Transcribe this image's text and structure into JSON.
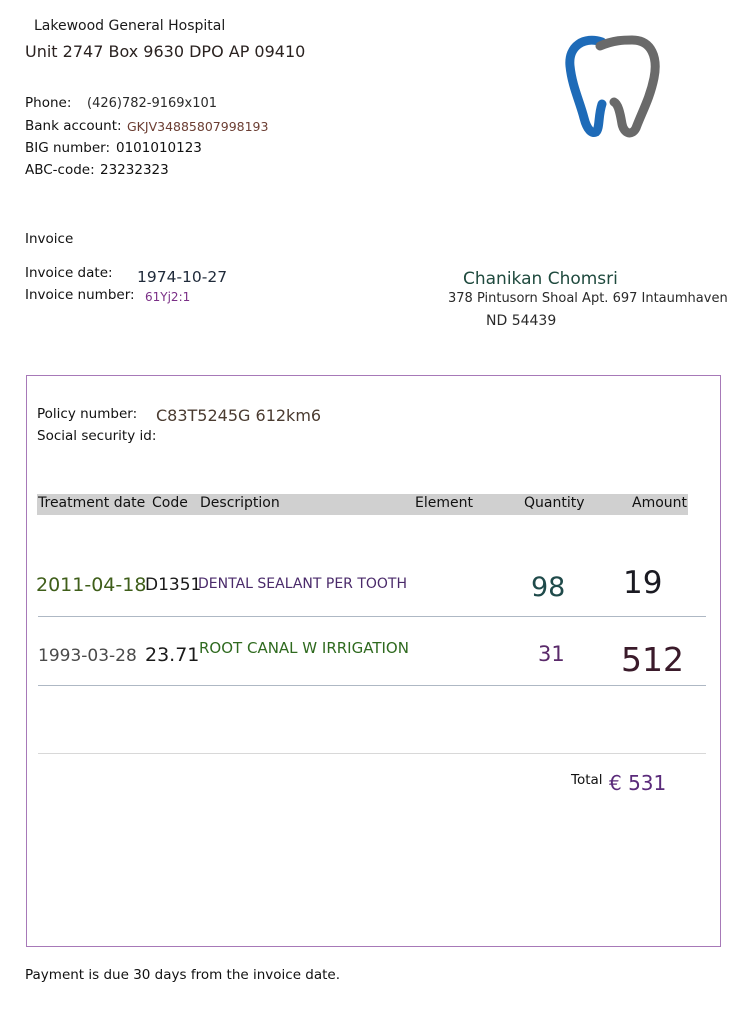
{
  "hospital": {
    "name": "Lakewood General Hospital",
    "address": "Unit 2747 Box 9630 DPO AP 09410",
    "phone_label": "Phone:",
    "phone": "(426)782-9169x101",
    "bank_label": "Bank account:",
    "bank": "GKJV34885807998193",
    "big_label": "BIG number:",
    "big": "0101010123",
    "abc_label": "ABC-code:",
    "abc": "23232323",
    "logo_icon": "tooth-logo-icon",
    "logo_colors": {
      "blue": "#1e6bb8",
      "gray": "#6a6a6a"
    }
  },
  "invoice": {
    "heading": "Invoice",
    "date_label": "Invoice date:",
    "date": "1974-10-27",
    "number_label": "Invoice number:",
    "number": "61Yj2:1"
  },
  "patient": {
    "name": "Chanikan Chomsri",
    "address_line1": "378 Pintusorn Shoal Apt. 697 Intaumhaven",
    "address_line2": "ND 54439"
  },
  "policy": {
    "policy_label": "Policy number:",
    "policy_value": "C83T5245G 612km6",
    "ssn_label": "Social security id:"
  },
  "table": {
    "headers": [
      "Treatment date",
      "Code",
      "Description",
      "Element",
      "Quantity",
      "Amount"
    ],
    "rows": [
      {
        "date": "2011-04-18",
        "code": "D1351",
        "description": "DENTAL SEALANT PER TOOTH",
        "element": "",
        "quantity": "98",
        "amount": "19"
      },
      {
        "date": "1993-03-28",
        "code": "23.71",
        "description": "ROOT CANAL W IRRIGATION",
        "element": "",
        "quantity": "31",
        "amount": "512"
      }
    ]
  },
  "total": {
    "label": "Total",
    "value": "€ 531"
  },
  "footer": {
    "note": "Payment is due 30 days from the invoice date."
  }
}
